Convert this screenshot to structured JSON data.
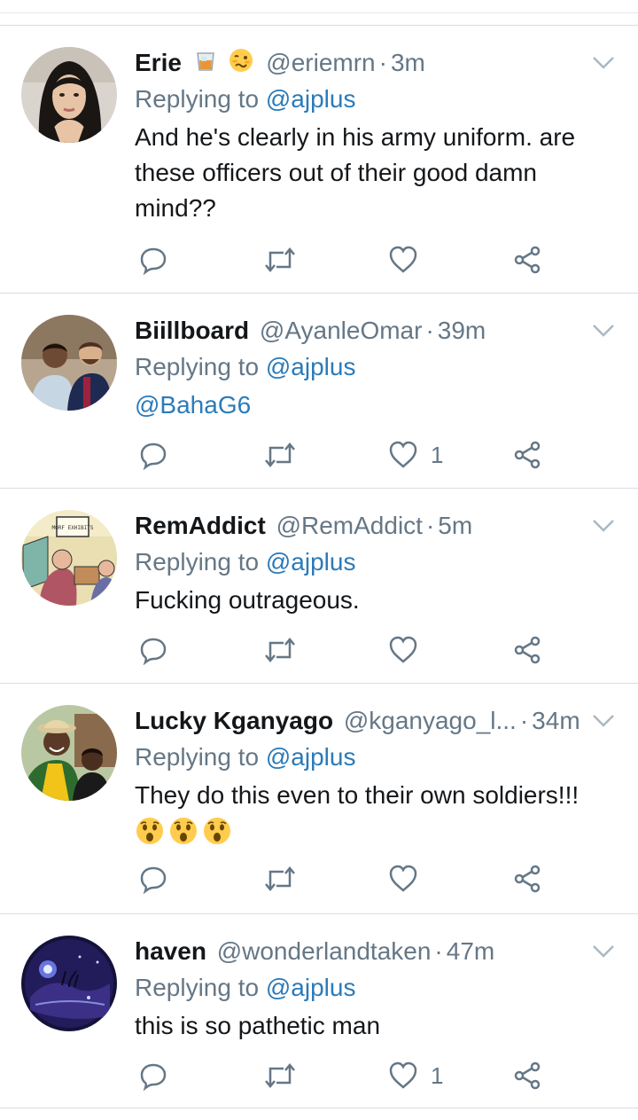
{
  "tweets": [
    {
      "name": "Erie",
      "handle": "@eriemrn",
      "time": "3m",
      "replying_prefix": "Replying to ",
      "replying_to": "@ajplus",
      "text": "And he's clearly in his army uniform. are these officers out of their good damn mind??",
      "likes": "",
      "avatar": "woman-portrait",
      "emojis": [
        "whiskey-glass-icon",
        "woozy-face-icon"
      ]
    },
    {
      "name": "Biillboard",
      "handle": "@AyanleOmar",
      "time": "39m",
      "replying_prefix": "Replying to ",
      "replying_to": "@ajplus",
      "text": "@BahaG6",
      "likes": "1",
      "avatar": "two-men-photo"
    },
    {
      "name": "RemAddict",
      "handle": "@RemAddict",
      "time": "5m",
      "replying_prefix": "Replying to ",
      "replying_to": "@ajplus",
      "text": "Fucking outrageous.",
      "likes": "",
      "avatar": "cartoon-exhibits",
      "avatar_text": "MORF EXHIBITS"
    },
    {
      "name": "Lucky Kganyago",
      "handle": "@kganyago_l...",
      "time": "34m",
      "replying_prefix": "Replying to ",
      "replying_to": "@ajplus",
      "text": "They do this even to their own soldiers!!!",
      "text_emojis": "😲😲😲",
      "likes": "",
      "avatar": "couple-photo"
    },
    {
      "name": "haven",
      "handle": "@wonderlandtaken",
      "time": "47m",
      "replying_prefix": "Replying to ",
      "replying_to": "@ajplus",
      "text": "this is so pathetic man",
      "likes": "1",
      "avatar": "cheshire-cat-art"
    }
  ],
  "colors": {
    "mention": "#2b7bb9",
    "muted": "#657786",
    "text": "#14171a",
    "divider": "#d8dee3"
  }
}
